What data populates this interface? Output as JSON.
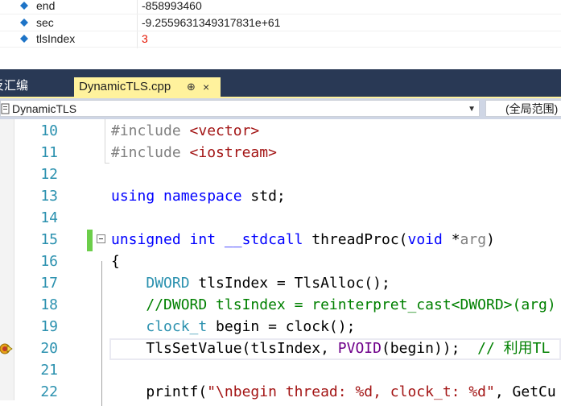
{
  "watch": {
    "rows": [
      {
        "name": "end",
        "value": "-858993460",
        "changed": false
      },
      {
        "name": "sec",
        "value": "-9.2559631349317831e+61",
        "changed": false
      },
      {
        "name": "tlsIndex",
        "value": "3",
        "changed": true
      }
    ],
    "colors": {
      "changed_value": "#e51400",
      "icon": "#1e74c7"
    }
  },
  "tabs": {
    "left_partial_label": "反汇编",
    "active_label": "DynamicTLS.cpp",
    "pin_glyph": "⊕",
    "close_glyph": "×"
  },
  "navbar": {
    "scope_label": "DynamicTLS",
    "member_label": "(全局范围)"
  },
  "editor": {
    "lines": [
      {
        "num": "10"
      },
      {
        "num": "11"
      },
      {
        "num": "12"
      },
      {
        "num": "13"
      },
      {
        "num": "14"
      },
      {
        "num": "15"
      },
      {
        "num": "16"
      },
      {
        "num": "17"
      },
      {
        "num": "18"
      },
      {
        "num": "19"
      },
      {
        "num": "20"
      },
      {
        "num": "21"
      },
      {
        "num": "22"
      }
    ],
    "code": {
      "l10_a": "#include ",
      "l10_b": "<vector>",
      "l11_a": "#include ",
      "l11_b": "<iostream>",
      "l13_a": "using",
      "l13_b": " ",
      "l13_c": "namespace",
      "l13_d": " std;",
      "l15_a": "unsigned",
      "l15_b": " ",
      "l15_c": "int",
      "l15_d": " ",
      "l15_e": "__stdcall",
      "l15_f": " threadProc(",
      "l15_g": "void",
      "l15_h": " *",
      "l15_i": "arg",
      "l15_j": ")",
      "l16_a": "{",
      "l17_a": "    ",
      "l17_b": "DWORD",
      "l17_c": " tlsIndex = TlsAlloc();",
      "l18_a": "    ",
      "l18_b": "//DWORD tlsIndex = reinterpret_cast<DWORD>(arg)",
      "l19_a": "    ",
      "l19_b": "clock_t",
      "l19_c": " begin = clock();",
      "l20_a": "    TlsSetValue(tlsIndex, ",
      "l20_b": "PVOID",
      "l20_c": "(begin));  ",
      "l20_d": "// 利用TL",
      "l22_a": "    printf(",
      "l22_b": "\"\\nbegin thread: %d, clock_t: %d\"",
      "l22_c": ", GetCu"
    },
    "colors": {
      "keyword": "#0000ff",
      "type": "#2b91af",
      "preprocessor": "#808080",
      "string": "#a31515",
      "comment": "#008000",
      "macro": "#6f008a",
      "line_number": "#2b91af",
      "change_bar": "#6cce4a"
    }
  }
}
